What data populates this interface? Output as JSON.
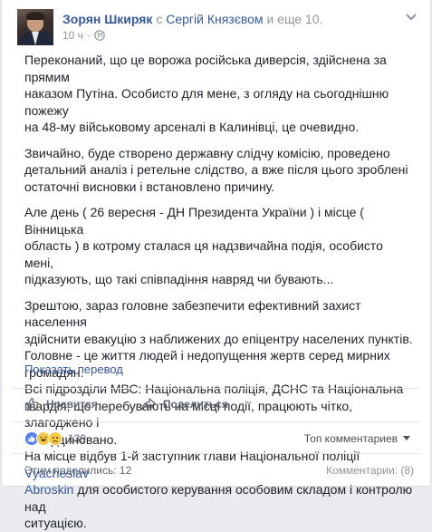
{
  "header": {
    "author": "Зорян Шкиряк",
    "with_prefix": "с",
    "tagged": "Сергій Князєвом",
    "and_more": "и еще 10.",
    "time": "10 ч",
    "separator": "·"
  },
  "post": {
    "paragraphs": [
      {
        "lines": [
          "Переконаний, що це ворожа російська диверсія, здійснена за прямим",
          "наказом Путіна. Особисто для мене, з огляду на сьогоднішню пожежу",
          "на 48-му військовому арсеналі в Калинівці, це очевидно."
        ]
      },
      {
        "lines": [
          "Звичайно, буде створено державну слідчу комісію, проведено",
          "детальний аналіз і ретельне слідство, а вже після цього зроблені",
          "остаточні висновки і встановлено причину."
        ]
      },
      {
        "lines": [
          "Але день ( 26 вересня - ДН Президента України ) і місце ( Вінницька",
          "область ) в котрому сталася ця надзвичайна подія, особисто мені,",
          "підказують, що такі співпадіння навряд чи бувають..."
        ]
      }
    ],
    "last": {
      "lines": [
        "Зрештою, зараз головне забезпечити ефективний захист населення",
        "здійснити евакуцію з наближених до епіцентру населених пунктів.",
        "Головне - це життя людей і недопущення жертв серед мирних",
        "громадян.",
        "Всі підрозділи МВС: Національна поліція, ДСНС та Національна",
        "гвардія, що перебувають на місці події, працюють чітко, злагоджено і",
        "скоординовано."
      ],
      "final_line1_pre": "На місце відбув 1-й заступник глави Національної поліції ",
      "final_link1": "Vyacheslav",
      "final_link2": "Abroskin",
      "final_line2_post": " для особистого керування особовим складом і контролю над",
      "final_line3": "ситуацією."
    },
    "translate": "Показать перевод"
  },
  "actions": {
    "like": "Нравится",
    "share": "Поделиться"
  },
  "reactions": {
    "count": "139",
    "top_comments": "Топ комментариев"
  },
  "footer": {
    "shares": "Этим поделились: 12",
    "comments": "Комментарии: (8)"
  },
  "colors": {
    "link": "#365899",
    "like_blue": "#4f80f0",
    "emoji_yellow": "#f7c94b"
  }
}
